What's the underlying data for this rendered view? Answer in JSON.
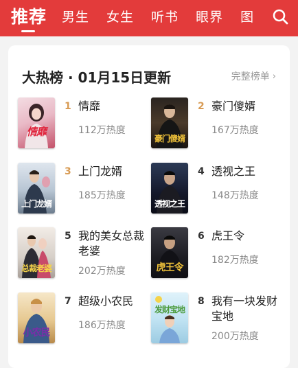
{
  "nav": {
    "tabs": [
      "推荐",
      "男生",
      "女生",
      "听书",
      "眼界",
      "图"
    ],
    "active_tab": "推荐",
    "accent": "#e33b3b",
    "search_icon": "search-icon"
  },
  "ranking": {
    "title": "大热榜 · 01月15日更新",
    "more_label": "完整榜单",
    "more_icon": "chevron-right-icon",
    "books": [
      {
        "rank": "1",
        "title": "情靡",
        "heat": "112万热度",
        "cover_text": "情靡"
      },
      {
        "rank": "2",
        "title": "豪门傻婿",
        "heat": "167万热度",
        "cover_text": "豪门傻婿"
      },
      {
        "rank": "3",
        "title": "上门龙婿",
        "heat": "185万热度",
        "cover_text": "上门龙婿"
      },
      {
        "rank": "4",
        "title": "透视之王",
        "heat": "148万热度",
        "cover_text": "透视之王"
      },
      {
        "rank": "5",
        "title": "我的美女总裁老婆",
        "heat": "202万热度",
        "cover_text": "总裁老婆"
      },
      {
        "rank": "6",
        "title": "虎王令",
        "heat": "182万热度",
        "cover_text": "虎王令"
      },
      {
        "rank": "7",
        "title": "超级小农民",
        "heat": "186万热度",
        "cover_text": "小农民"
      },
      {
        "rank": "8",
        "title": "我有一块发财宝地",
        "heat": "200万热度",
        "cover_text": "发财宝地"
      }
    ],
    "rank_colors": {
      "top": "#d89b54",
      "rest": "#333333"
    }
  }
}
